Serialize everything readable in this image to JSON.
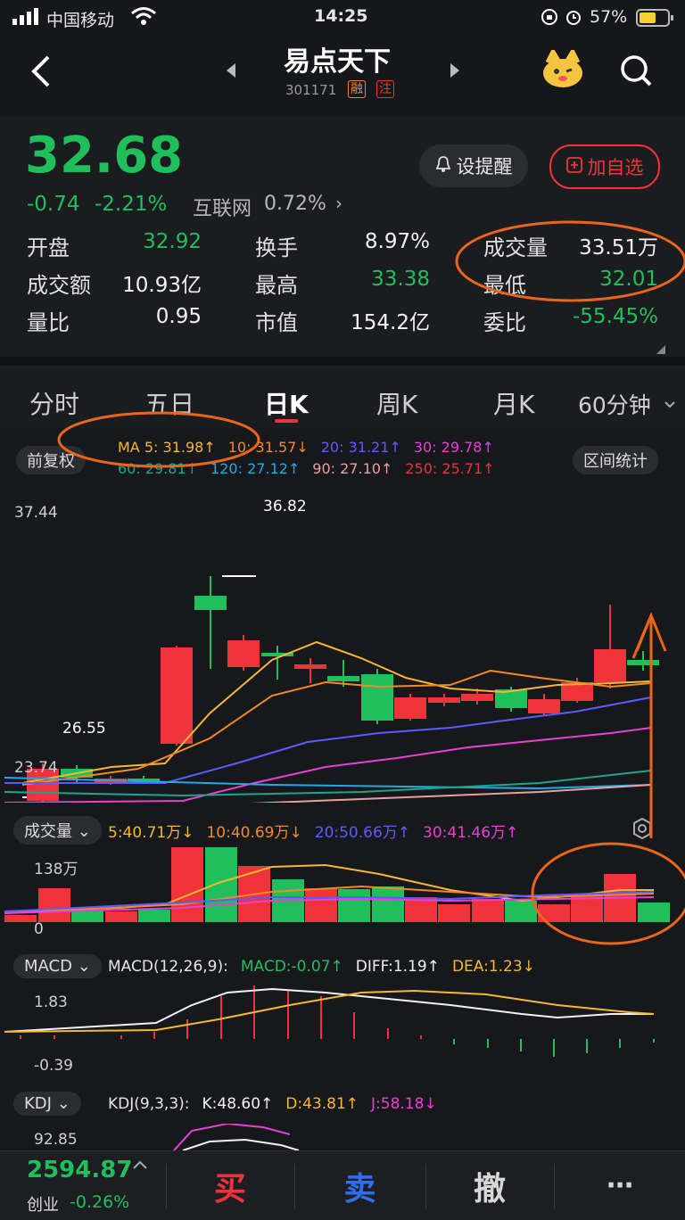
{
  "status_bar": {
    "carrier": "中国移动",
    "time": "14:25",
    "battery": "57%"
  },
  "header": {
    "title": "易点天下",
    "code": "301171",
    "tag_rong": "融",
    "tag_zhu": "注"
  },
  "quote": {
    "price": "32.68",
    "change": "-0.74",
    "change_pct": "-2.21%",
    "sector": "互联网",
    "sector_pct": "0.72%",
    "alert_btn": "设提醒",
    "watch_btn": "加自选",
    "stats": [
      {
        "label": "开盘",
        "value": "32.92",
        "color": "green"
      },
      {
        "label": "换手",
        "value": "8.97%",
        "color": "white"
      },
      {
        "label": "成交量",
        "value": "33.51万",
        "color": "white"
      },
      {
        "label": "成交额",
        "value": "10.93亿",
        "color": "white"
      },
      {
        "label": "最高",
        "value": "33.38",
        "color": "green"
      },
      {
        "label": "最低",
        "value": "32.01",
        "color": "green"
      },
      {
        "label": "量比",
        "value": "0.95",
        "color": "white"
      },
      {
        "label": "市值",
        "value": "154.2亿",
        "color": "white"
      },
      {
        "label": "委比",
        "value": "-55.45%",
        "color": "green"
      }
    ]
  },
  "tabs": [
    "分时",
    "五日",
    "日K",
    "周K",
    "月K",
    "60分钟"
  ],
  "active_tab": "日K",
  "chart": {
    "adjust_btn": "前复权",
    "range_btn": "区间统计",
    "ma_row1": [
      {
        "text": "MA 5: 31.98↑",
        "color": "#f5b82e"
      },
      {
        "text": "10: 31.57↓",
        "color": "#f08a24"
      },
      {
        "text": "20: 31.21↑",
        "color": "#5b5cff"
      },
      {
        "text": "30: 29.78↑",
        "color": "#e83fd6"
      }
    ],
    "ma_row2": [
      {
        "text": "60: 29.81↑",
        "color": "#1aa58c"
      },
      {
        "text": "120: 27.12↑",
        "color": "#22a9e8"
      },
      {
        "text": "90: 27.10↑",
        "color": "#e8a0a0"
      },
      {
        "text": "250: 25.71↑",
        "color": "#d9393a"
      }
    ],
    "price_high_label": "37.44",
    "price_low_label": "23.74",
    "max_label": "36.82",
    "min_label": "26.55",
    "volume_btn": "成交量",
    "volume_legend": [
      {
        "text": "5:40.71万↓",
        "color": "#f5b82e"
      },
      {
        "text": "10:40.69万↓",
        "color": "#f08a24"
      },
      {
        "text": "20:50.66万↑",
        "color": "#5b5cff"
      },
      {
        "text": "30:41.46万↑",
        "color": "#e83fd6"
      }
    ],
    "volume_max": "138万",
    "volume_zero": "0",
    "macd_btn": "MACD",
    "macd_legend": [
      {
        "text": "MACD(12,26,9):",
        "color": "#e6e6e6"
      },
      {
        "text": "MACD:-0.07↑",
        "color": "#1fbf5b"
      },
      {
        "text": "DIFF:1.19↑",
        "color": "#f2f2f2"
      },
      {
        "text": "DEA:1.23↓",
        "color": "#f5b82e"
      }
    ],
    "macd_high": "1.83",
    "macd_low": "-0.39",
    "kdj_btn": "KDJ",
    "kdj_legend": [
      {
        "text": "KDJ(9,3,3):",
        "color": "#e6e6e6"
      },
      {
        "text": "K:48.60↑",
        "color": "#f2f2f2"
      },
      {
        "text": "D:43.81↑",
        "color": "#f5b82e"
      },
      {
        "text": "J:58.18↓",
        "color": "#e83fd6"
      }
    ],
    "kdj_high": "92.85"
  },
  "bottom": {
    "index_value": "2594.87",
    "index_name": "创业",
    "index_pct": "-0.26%",
    "buy": "买",
    "sell": "卖",
    "cancel": "撤",
    "more": "⋯"
  },
  "colors": {
    "up": "#f0333a",
    "down": "#1fbf5b",
    "annotation": "#e8661b"
  }
}
